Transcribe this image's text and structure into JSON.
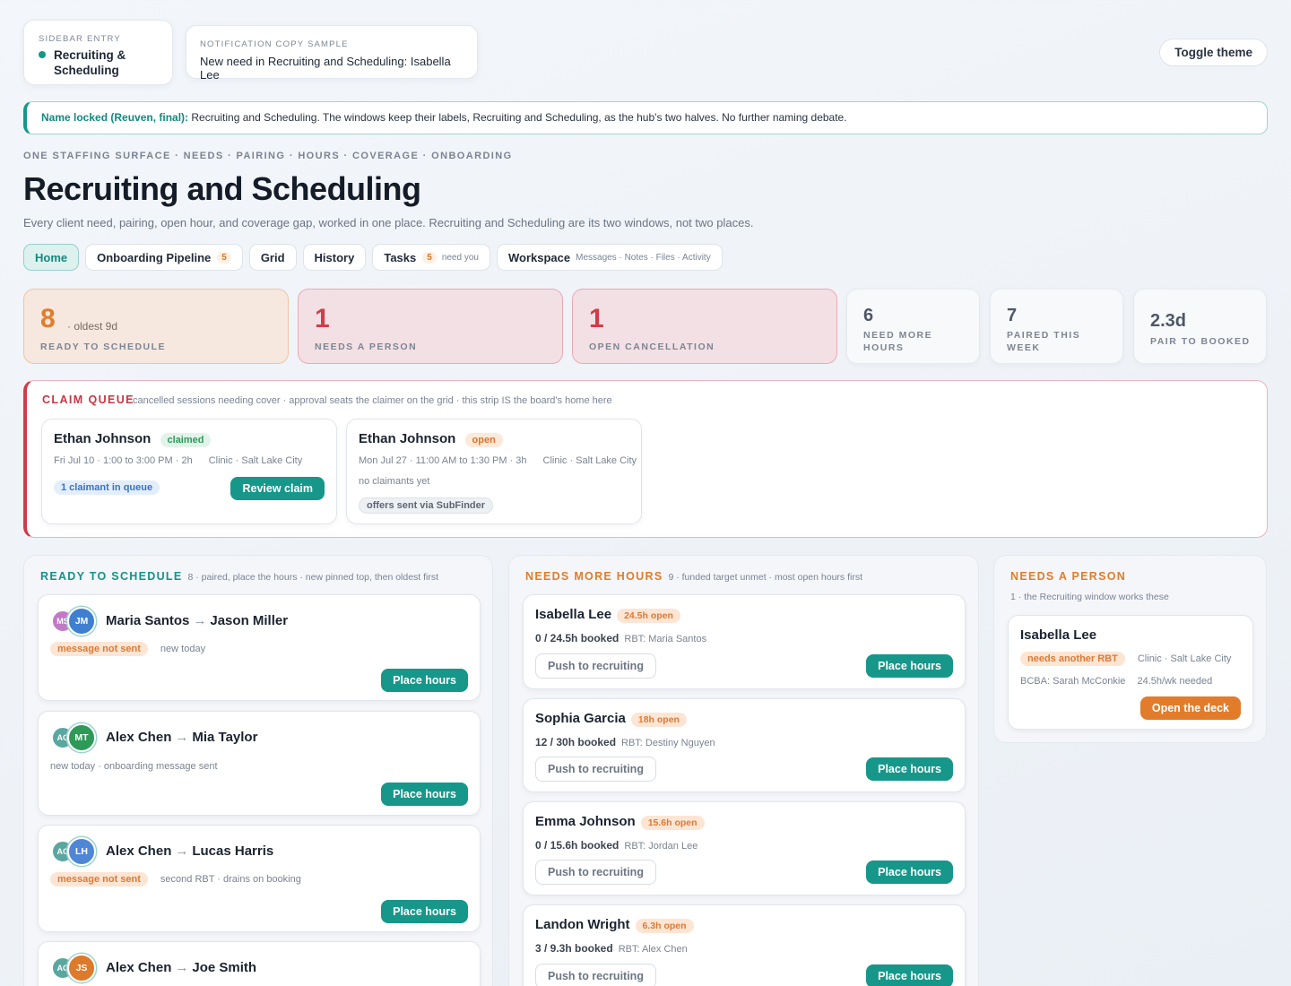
{
  "topbar": {
    "sidebar_entry_label": "SIDEBAR ENTRY",
    "sidebar_entry_name": "Recruiting & Scheduling",
    "notification_label": "NOTIFICATION COPY SAMPLE",
    "notification_text": "New need in Recruiting and Scheduling: Isabella Lee",
    "toggle_theme": "Toggle theme"
  },
  "banner": {
    "strong": "Name locked (Reuven, final):",
    "text": " Recruiting and Scheduling. The windows keep their labels, Recruiting and Scheduling, as the hub's two halves. No further naming debate."
  },
  "header": {
    "eyebrow": "ONE STAFFING SURFACE · NEEDS · PAIRING · HOURS · COVERAGE · ONBOARDING",
    "title": "Recruiting and Scheduling",
    "subtitle": "Every client need, pairing, open hour, and coverage gap, worked in one place. Recruiting and Scheduling are its two windows, not two places."
  },
  "tabs": [
    {
      "label": "Home",
      "count": "",
      "hint": ""
    },
    {
      "label": "Onboarding Pipeline",
      "count": "5",
      "hint": ""
    },
    {
      "label": "Grid",
      "count": "",
      "hint": ""
    },
    {
      "label": "History",
      "count": "",
      "hint": ""
    },
    {
      "label": "Tasks",
      "count": "5",
      "hint": "need you"
    },
    {
      "label": "Workspace",
      "count": "",
      "hint": "Messages · Notes · Files · Activity"
    }
  ],
  "stats": [
    {
      "value": "8",
      "aside": "· oldest 9d",
      "label": "READY TO SCHEDULE"
    },
    {
      "value": "1",
      "label": "NEEDS A PERSON"
    },
    {
      "value": "1",
      "label": "OPEN CANCELLATION"
    },
    {
      "value": "6",
      "label_l1": "NEED MORE",
      "label_l2": "HOURS"
    },
    {
      "value": "7",
      "label_l1": "PAIRED THIS",
      "label_l2": "WEEK"
    },
    {
      "value": "2.3d",
      "label": "PAIR TO BOOKED"
    }
  ],
  "claim_queue": {
    "title": "CLAIM QUEUE",
    "subtitle": "cancelled sessions needing cover · approval seats the claimer on the grid · this strip IS the board's home here",
    "cards": [
      {
        "name": "Ethan Johnson",
        "status": "claimed",
        "when": "Fri Jul 10 · 1:00 to 3:00 PM · 2h",
        "where": "Clinic · Salt Lake City",
        "tag": "1 claimant in queue",
        "action": "Review claim"
      },
      {
        "name": "Ethan Johnson",
        "status": "open",
        "when": "Mon Jul 27 · 11:00 AM to 1:30 PM · 3h",
        "where": "Clinic · Salt Lake City",
        "note": "no claimants yet",
        "tag": "offers sent via SubFinder"
      }
    ]
  },
  "ready": {
    "title": "READY TO SCHEDULE",
    "subtitle": "8 · paired, place the hours · new pinned top, then oldest first",
    "cards": [
      {
        "back": "MS",
        "front": "JM",
        "from": "Maria Santos",
        "to": "Jason Miller",
        "pill": "message not sent",
        "note": "new today",
        "action": "Place hours"
      },
      {
        "back": "AC",
        "front": "MT",
        "from": "Alex Chen",
        "to": "Mia Taylor",
        "pill": "",
        "note": "new today · onboarding message sent",
        "action": "Place hours"
      },
      {
        "back": "AC",
        "front": "LH",
        "from": "Alex Chen",
        "to": "Lucas Harris",
        "pill": "message not sent",
        "note": "second RBT · drains on booking",
        "action": "Place hours"
      },
      {
        "back": "AC",
        "front": "JS",
        "from": "Alex Chen",
        "to": "Joe Smith",
        "pill": "",
        "note": "",
        "action": ""
      }
    ]
  },
  "more_hours": {
    "title": "NEEDS MORE HOURS",
    "subtitle": "9 · funded target unmet · most open hours first",
    "cards": [
      {
        "name": "Isabella Lee",
        "open": "24.5h open",
        "booked": "0 / 24.5h booked",
        "rbt": "RBT: Maria Santos",
        "push": "Push to recruiting",
        "action": "Place hours"
      },
      {
        "name": "Sophia Garcia",
        "open": "18h open",
        "booked": "12 / 30h booked",
        "rbt": "RBT: Destiny Nguyen",
        "push": "Push to recruiting",
        "action": "Place hours"
      },
      {
        "name": "Emma Johnson",
        "open": "15.6h open",
        "booked": "0 / 15.6h booked",
        "rbt": "RBT: Jordan Lee",
        "push": "Push to recruiting",
        "action": "Place hours"
      },
      {
        "name": "Landon Wright",
        "open": "6.3h open",
        "booked": "3 / 9.3h booked",
        "rbt": "RBT: Alex Chen",
        "push": "Push to recruiting",
        "action": "Place hours"
      }
    ]
  },
  "needs_person": {
    "title": "NEEDS A PERSON",
    "subtitle": "1 · the Recruiting window works these",
    "card": {
      "name": "Isabella Lee",
      "pill": "needs another RBT",
      "where": "Clinic · Salt Lake City",
      "bcba": "BCBA: Sarah McConkie",
      "hours": "24.5h/wk needed",
      "action": "Open the deck"
    }
  },
  "colors": {
    "teal": "#16978a",
    "orange": "#e27c2a",
    "red": "#d03b48",
    "av_ms": "#c27ac6",
    "av_jm": "#3f7fd0",
    "av_ac": "#5aa7a0",
    "av_mt": "#2e9a58",
    "av_lh": "#4f86d6",
    "av_js": "#de7a2c"
  }
}
